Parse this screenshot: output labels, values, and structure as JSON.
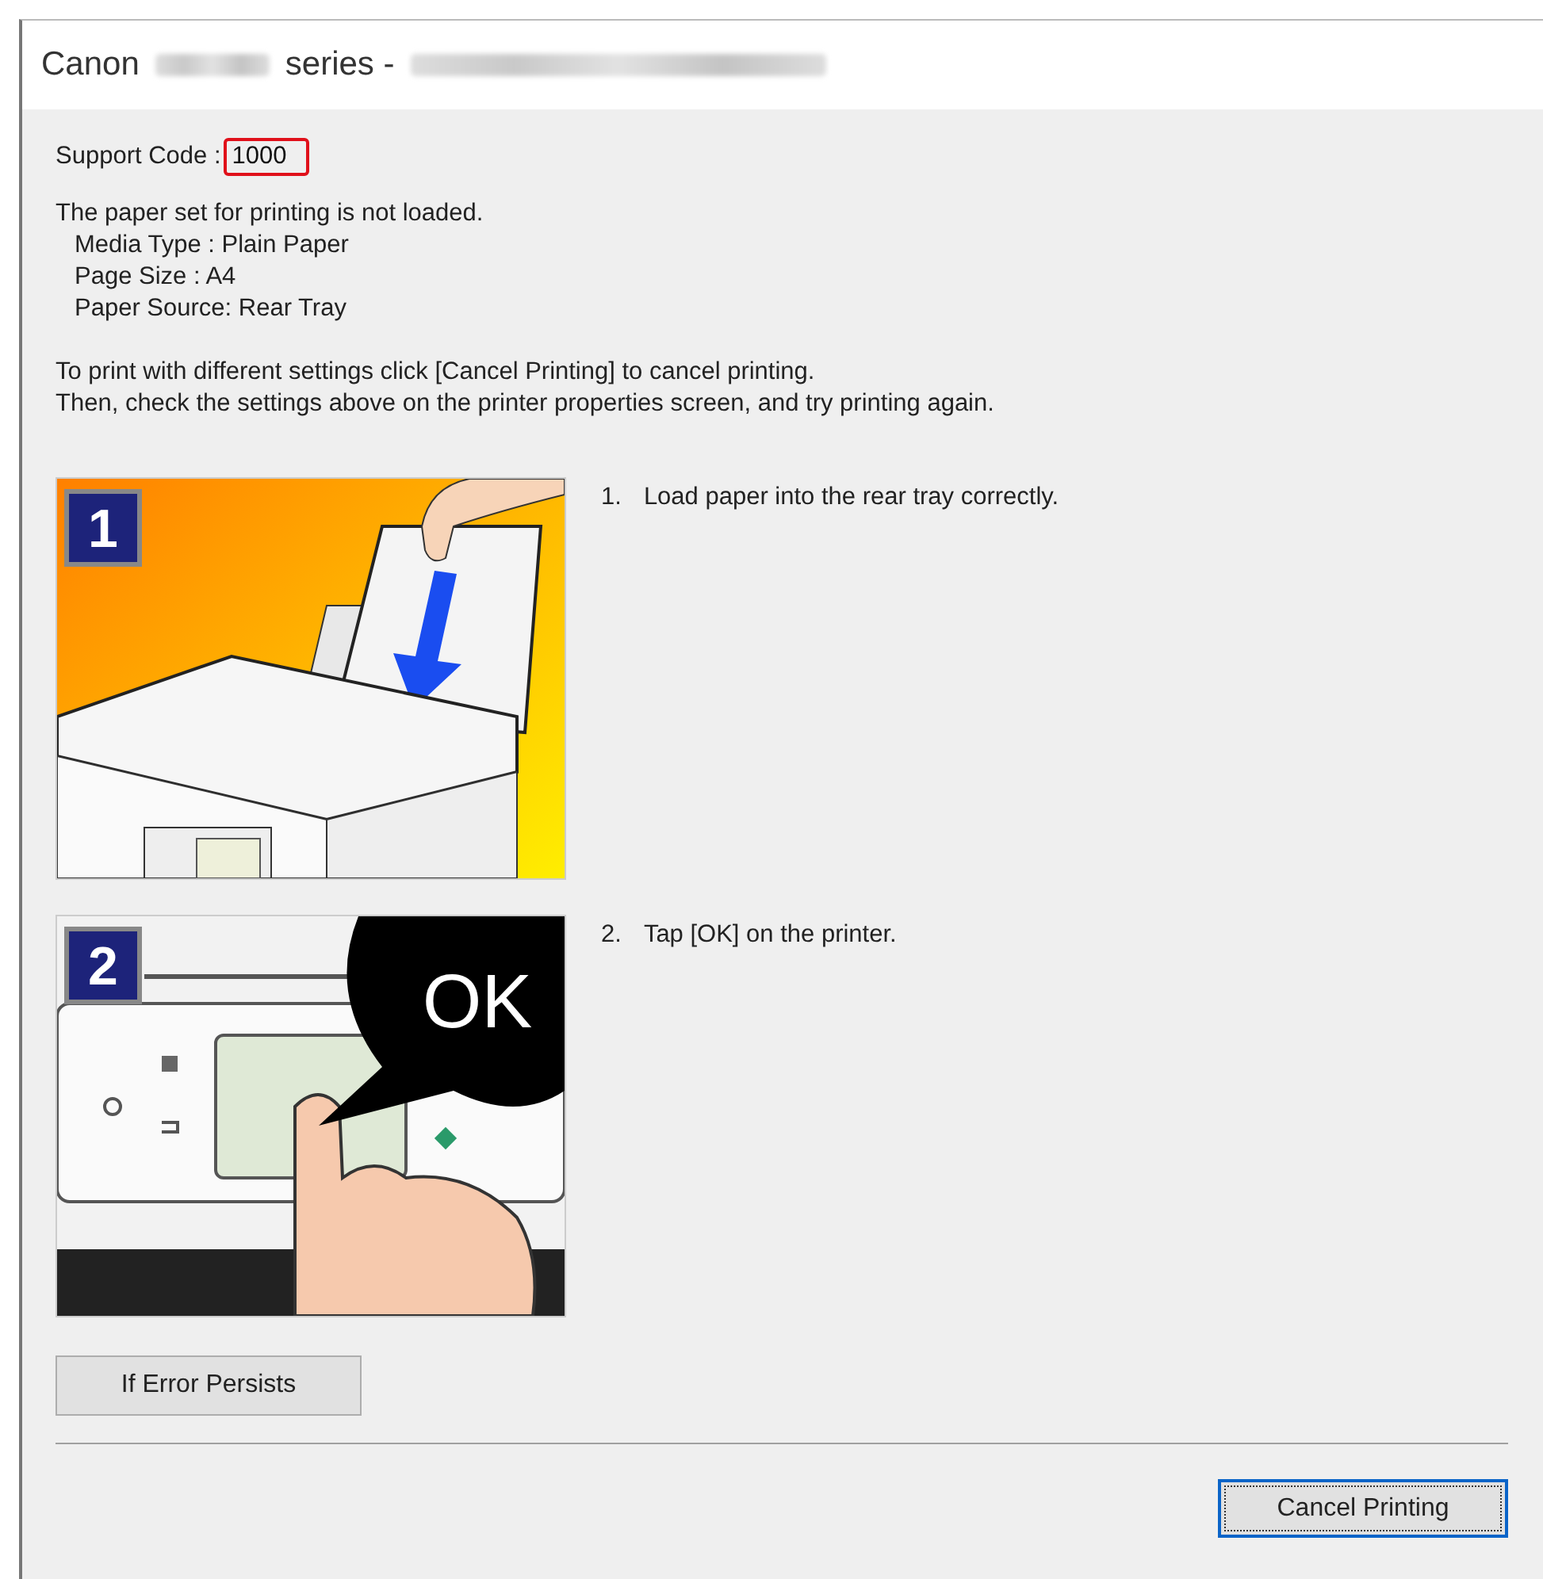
{
  "window": {
    "title_parts": [
      "Canon",
      "series -"
    ]
  },
  "support_code": {
    "label": "Support Code :",
    "code": "1000"
  },
  "message": [
    "The paper set for printing is not loaded.",
    "Media Type : Plain Paper",
    "Page Size : A4",
    "Paper Source: Rear Tray"
  ],
  "instructions": [
    "To print with different settings click [Cancel Printing] to cancel printing.",
    "Then, check the settings above on the printer properties screen, and try printing again."
  ],
  "steps": [
    {
      "kind": "load-paper",
      "badge": "1",
      "number": "1.",
      "text": "Load paper into the rear tray correctly."
    },
    {
      "kind": "tap-ok",
      "badge": "2",
      "number": "2.",
      "text": "Tap [OK] on the printer.",
      "callout": "OK"
    }
  ],
  "buttons": [
    {
      "label": "If Error Persists",
      "focused": false
    },
    {
      "label": "Cancel Printing",
      "focused": true
    }
  ]
}
